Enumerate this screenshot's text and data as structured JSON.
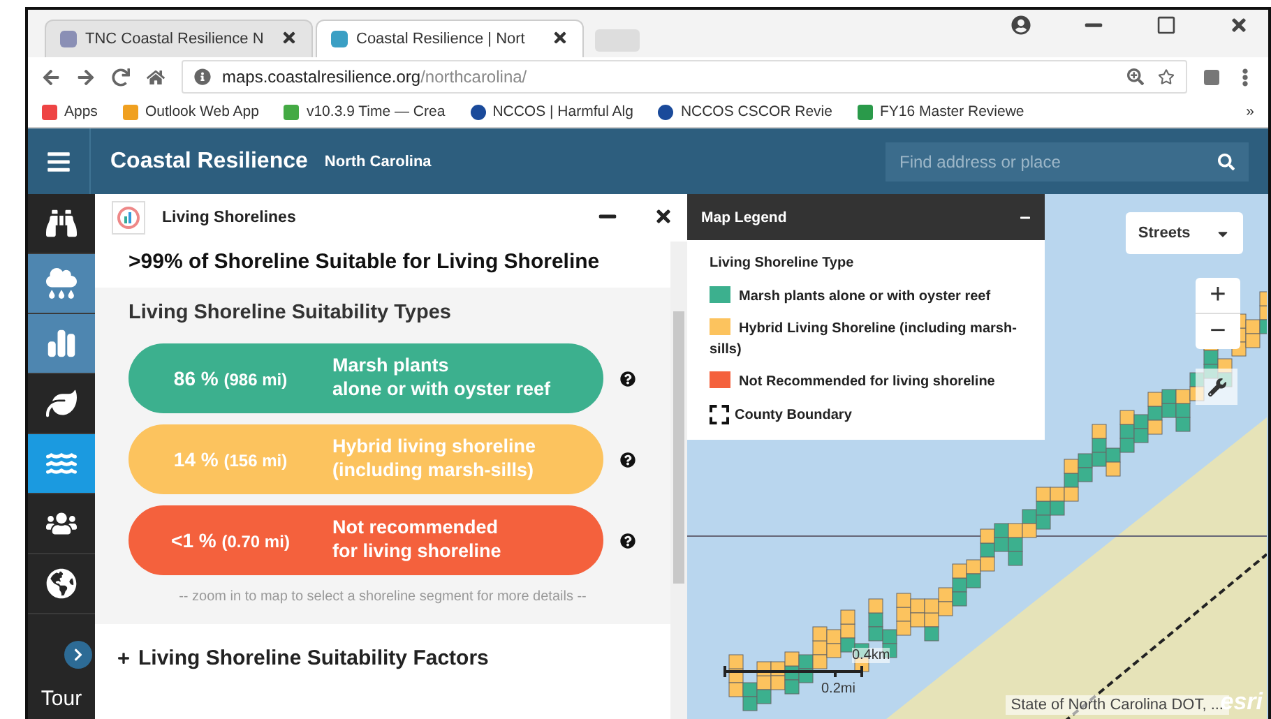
{
  "browser": {
    "tabs": [
      {
        "title": "TNC Coastal Resilience N",
        "selected": false
      },
      {
        "title": "Coastal Resilience | Nort",
        "selected": true
      }
    ],
    "url": {
      "host": "maps.coastalresilience.org",
      "path": "/northcarolina/"
    },
    "bookmarks": [
      {
        "label": "Apps",
        "kind": "apps"
      },
      {
        "label": "Outlook Web App",
        "kind": "outlook"
      },
      {
        "label": "v10.3.9 Time — Crea",
        "kind": "time"
      },
      {
        "label": "NCCOS | Harmful Alg",
        "kind": "noaa"
      },
      {
        "label": "NCCOS CSCOR Revie",
        "kind": "noaa"
      },
      {
        "label": "FY16 Master Reviewe",
        "kind": "sheet"
      }
    ],
    "more": "»"
  },
  "header": {
    "title": "Coastal Resilience",
    "subtitle": "North Carolina",
    "search": {
      "placeholder": "Find address or place"
    }
  },
  "sidebar": {
    "items": [
      {
        "kind": "binoculars",
        "selected": false,
        "highlighted": false
      },
      {
        "kind": "flood",
        "selected": false,
        "highlighted": true
      },
      {
        "kind": "chart",
        "selected": false,
        "highlighted": true
      },
      {
        "kind": "leaf",
        "selected": false,
        "highlighted": false
      },
      {
        "kind": "shore",
        "selected": true,
        "highlighted": false
      },
      {
        "kind": "people",
        "selected": false,
        "highlighted": false
      },
      {
        "kind": "globe",
        "selected": false,
        "highlighted": false
      }
    ],
    "tour": "Tour"
  },
  "panel": {
    "title": "Living Shorelines",
    "summary": ">99% of Shoreline Suitable for Living Shoreline",
    "section": "Living Shoreline Suitability Types",
    "types": [
      {
        "percent": "86 %",
        "miles": "(986 mi)",
        "lines": [
          "Marsh plants",
          "alone or with oyster reef"
        ],
        "color": "#3cb08e"
      },
      {
        "percent": "14 %",
        "miles": "(156 mi)",
        "lines": [
          "Hybrid living shoreline",
          "(including marsh-sills)"
        ],
        "color": "#fcc35e"
      },
      {
        "percent": "<1 %",
        "miles": "(0.70 mi)",
        "lines": [
          "Not recommended",
          "for living shoreline"
        ],
        "color": "#f4613d"
      }
    ],
    "hint": "-- zoom in to map to select a shoreline segment for more details --",
    "factors": "Living Shoreline Suitability Factors",
    "factors_expanded": false
  },
  "legend": {
    "title": "Map Legend",
    "heading": "Living Shoreline Type",
    "items": [
      {
        "label": "Marsh plants alone or with oyster reef",
        "color": "#3cb08e",
        "kind": "swatch"
      },
      {
        "label": "Hybrid Living Shoreline (including marsh-sills)",
        "color": "#fcc35e",
        "kind": "swatch"
      },
      {
        "label": "Not Recommended for living shoreline",
        "color": "#f4613d",
        "kind": "swatch"
      },
      {
        "label": "County Boundary",
        "kind": "boundary"
      }
    ]
  },
  "map": {
    "basemap": "Streets",
    "zoom_in": "+",
    "zoom_out": "−",
    "scale_km": "0.4km",
    "scale_mi": "0.2mi",
    "attribution": "State of North Carolina DOT, ...",
    "logo": "esri"
  }
}
